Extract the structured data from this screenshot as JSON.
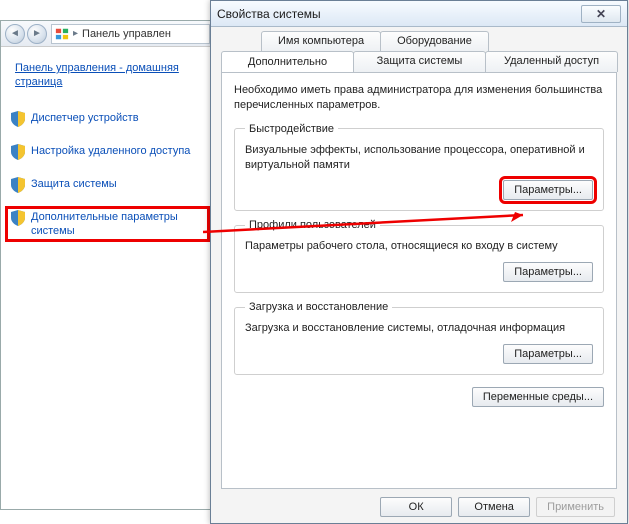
{
  "back_window": {
    "breadcrumb": "Панель управлен",
    "home_link": "Панель управления - домашняя страница",
    "items": [
      {
        "label": "Диспетчер устройств"
      },
      {
        "label": "Настройка удаленного доступа"
      },
      {
        "label": "Защита системы"
      },
      {
        "label": "Дополнительные параметры системы"
      }
    ]
  },
  "dialog": {
    "title": "Свойства системы",
    "tabs_top": [
      {
        "label": "Имя компьютера"
      },
      {
        "label": "Оборудование"
      }
    ],
    "tabs_bottom": [
      {
        "label": "Дополнительно"
      },
      {
        "label": "Защита системы"
      },
      {
        "label": "Удаленный доступ"
      }
    ],
    "admin_note": "Необходимо иметь права администратора для изменения большинства перечисленных параметров.",
    "groups": {
      "perf": {
        "legend": "Быстродействие",
        "desc": "Визуальные эффекты, использование процессора, оперативной и виртуальной памяти",
        "btn": "Параметры..."
      },
      "profiles": {
        "legend": "Профили пользователей",
        "desc": "Параметры рабочего стола, относящиеся ко входу в систему",
        "btn": "Параметры..."
      },
      "startup": {
        "legend": "Загрузка и восстановление",
        "desc": "Загрузка и восстановление системы, отладочная информация",
        "btn": "Параметры..."
      }
    },
    "env_btn": "Переменные среды...",
    "footer": {
      "ok": "ОК",
      "cancel": "Отмена",
      "apply": "Применить"
    }
  }
}
